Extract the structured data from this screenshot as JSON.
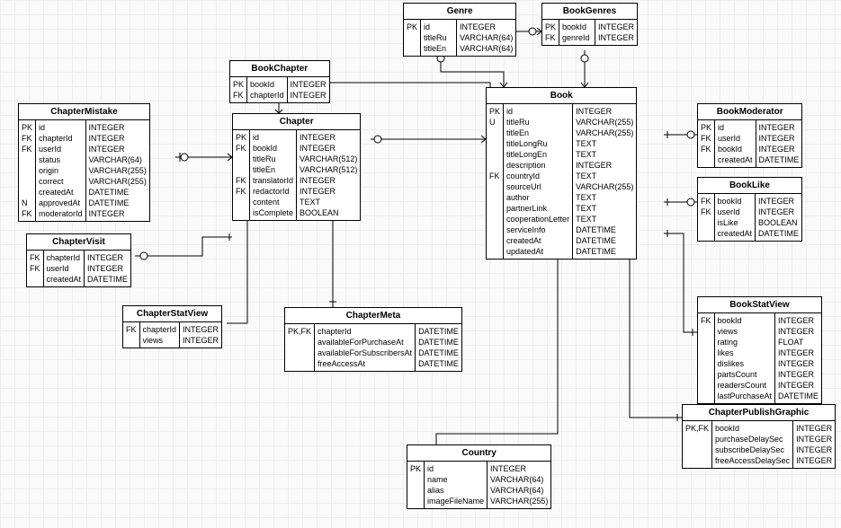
{
  "entities": {
    "Genre": {
      "title": "Genre",
      "keys": [
        "PK",
        "",
        ""
      ],
      "names": [
        "id",
        "titleRu",
        "titleEn"
      ],
      "types": [
        "INTEGER",
        "VARCHAR(64)",
        "VARCHAR(64)"
      ]
    },
    "BookGenres": {
      "title": "BookGenres",
      "keys": [
        "PK",
        "FK"
      ],
      "names": [
        "bookId",
        "genreId"
      ],
      "types": [
        "INTEGER",
        "INTEGER"
      ]
    },
    "BookChapter": {
      "title": "BookChapter",
      "keys": [
        "PK",
        "FK"
      ],
      "names": [
        "bookId",
        "chapterId"
      ],
      "types": [
        "INTEGER",
        "INTEGER"
      ]
    },
    "ChapterMistake": {
      "title": "ChapterMistake",
      "keys": [
        "PK",
        "FK",
        "FK",
        "",
        "",
        "",
        "",
        "N",
        "FK"
      ],
      "names": [
        "id",
        "chapterId",
        "userId",
        "status",
        "origin",
        "correct",
        "createdAt",
        "approvedAt",
        "moderatorId"
      ],
      "types": [
        "INTEGER",
        "INTEGER",
        "INTEGER",
        "VARCHAR(64)",
        "VARCHAR(255)",
        "VARCHAR(255)",
        "DATETIME",
        "DATETIME",
        "INTEGER"
      ]
    },
    "Chapter": {
      "title": "Chapter",
      "keys": [
        "PK",
        "FK",
        "",
        "",
        "FK",
        "FK",
        "",
        ""
      ],
      "names": [
        "id",
        "bookId",
        "titleRu",
        "titleEn",
        "translatorId",
        "redactorId",
        "content",
        "isComplete"
      ],
      "types": [
        "INTEGER",
        "INTEGER",
        "VARCHAR(512)",
        "VARCHAR(512)",
        "INTEGER",
        "INTEGER",
        "TEXT",
        "BOOLEAN"
      ]
    },
    "Book": {
      "title": "Book",
      "keys": [
        "PK",
        "U",
        "",
        "",
        "",
        "",
        "FK",
        "",
        "",
        "",
        "",
        "",
        "",
        ""
      ],
      "names": [
        "id",
        "titleRu",
        "titleEn",
        "titleLongRu",
        "titleLongEn",
        "description",
        "countryId",
        "sourceUrl",
        "author",
        "partnerLink",
        "cooperationLetter",
        "serviceInfo",
        "createdAt",
        "updatedAt"
      ],
      "types": [
        "INTEGER",
        "VARCHAR(255)",
        "VARCHAR(255)",
        "TEXT",
        "TEXT",
        "INTEGER",
        "TEXT",
        "VARCHAR(255)",
        "TEXT",
        "TEXT",
        "TEXT",
        "DATETIME",
        "DATETIME",
        "DATETIME"
      ]
    },
    "BookModerator": {
      "title": "BookModerator",
      "keys": [
        "PK",
        "FK",
        "FK",
        ""
      ],
      "names": [
        "id",
        "userId",
        "bookId",
        "createdAt"
      ],
      "types": [
        "INTEGER",
        "INTEGER",
        "INTEGER",
        "DATETIME"
      ]
    },
    "BookLike": {
      "title": "BookLike",
      "keys": [
        "FK",
        "FK",
        "",
        ""
      ],
      "names": [
        "bookId",
        "userId",
        "isLike",
        "createdAt"
      ],
      "types": [
        "INTEGER",
        "INTEGER",
        "BOOLEAN",
        "DATETIME"
      ]
    },
    "ChapterVisit": {
      "title": "ChapterVisit",
      "keys": [
        "FK",
        "FK",
        ""
      ],
      "names": [
        "chapterId",
        "userId",
        "createdAt"
      ],
      "types": [
        "INTEGER",
        "INTEGER",
        "DATETIME"
      ]
    },
    "ChapterStatView": {
      "title": "ChapterStatView",
      "keys": [
        "FK",
        ""
      ],
      "names": [
        "chapterId",
        "views"
      ],
      "types": [
        "INTEGER",
        "INTEGER"
      ]
    },
    "ChapterMeta": {
      "title": "ChapterMeta",
      "keys": [
        "PK,FK",
        "",
        "",
        ""
      ],
      "names": [
        "chapterId",
        "availableForPurchaseAt",
        "availableForSubscribersAt",
        "freeAccessAt"
      ],
      "types": [
        "DATETIME",
        "DATETIME",
        "DATETIME",
        "DATETIME"
      ]
    },
    "BookStatView": {
      "title": "BookStatView",
      "keys": [
        "FK",
        "",
        "",
        "",
        "",
        "",
        "",
        ""
      ],
      "names": [
        "bookId",
        "views",
        "rating",
        "likes",
        "dislikes",
        "partsCount",
        "readersCount",
        "lastPurchaseAt"
      ],
      "types": [
        "INTEGER",
        "INTEGER",
        "FLOAT",
        "INTEGER",
        "INTEGER",
        "INTEGER",
        "INTEGER",
        "DATETIME"
      ]
    },
    "Country": {
      "title": "Country",
      "keys": [
        "PK",
        "",
        "",
        ""
      ],
      "names": [
        "id",
        "name",
        "alias",
        "imageFileName"
      ],
      "types": [
        "INTEGER",
        "VARCHAR(64)",
        "VARCHAR(64)",
        "VARCHAR(255)"
      ]
    },
    "ChapterPublishGraphic": {
      "title": "ChapterPublishGraphic",
      "keys": [
        "PK,FK",
        "",
        "",
        ""
      ],
      "names": [
        "bookId",
        "purchaseDelaySec",
        "subscribeDelaySec",
        "freeAccessDelaySec"
      ],
      "types": [
        "INTEGER",
        "INTEGER",
        "INTEGER",
        "INTEGER"
      ]
    }
  }
}
